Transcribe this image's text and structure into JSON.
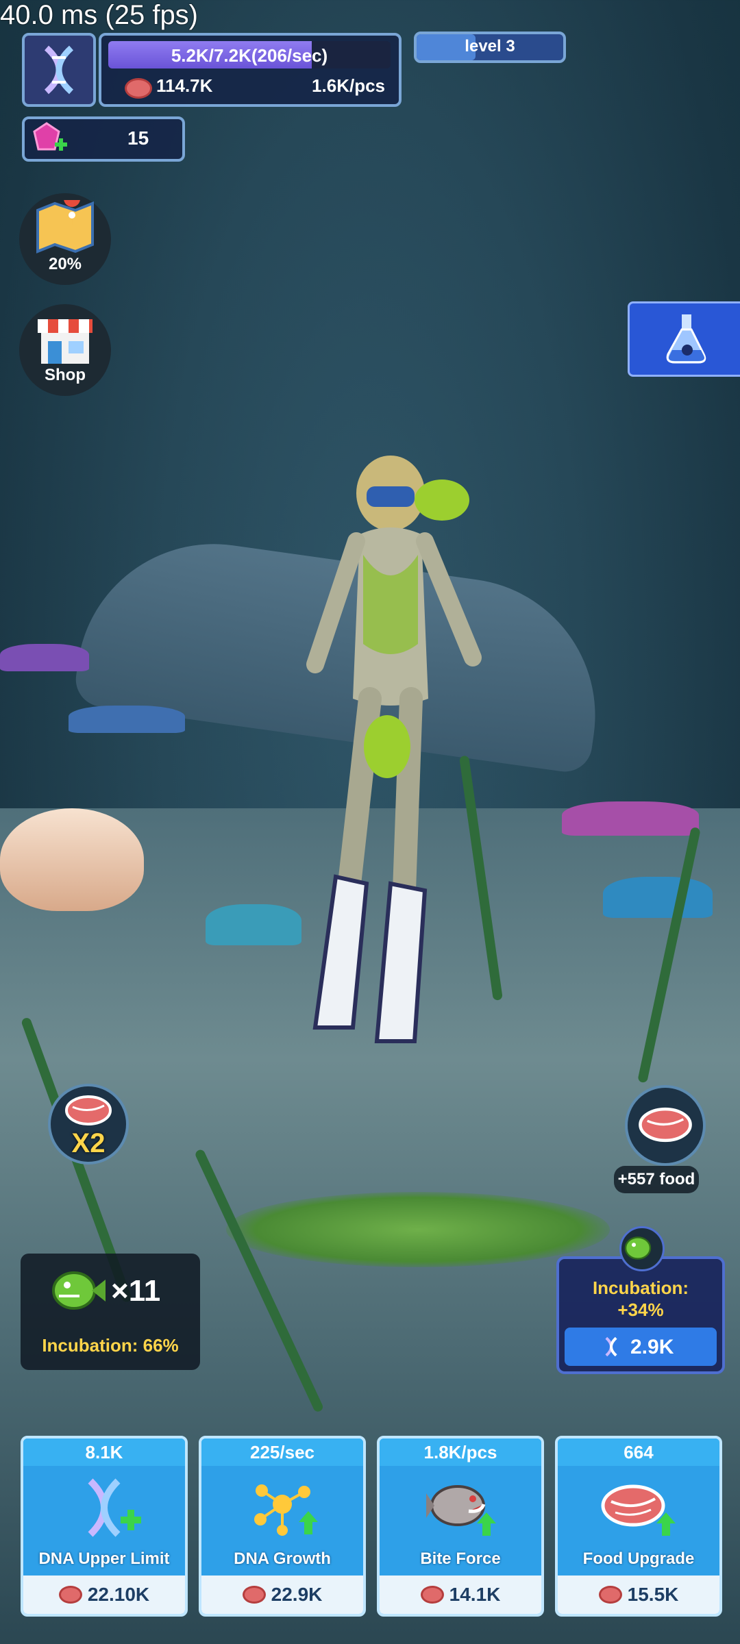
{
  "debug": {
    "fps_text": "40.0 ms (25 fps)"
  },
  "hud": {
    "dna": {
      "text": "5.2K/7.2K(206/sec)",
      "fill_fraction": 0.72
    },
    "food": {
      "amount": "114.7K",
      "rate": "1.6K/pcs"
    },
    "level": {
      "label": "level 3",
      "fill_fraction": 0.4
    },
    "gems": {
      "amount": "15"
    }
  },
  "side_buttons": {
    "map": {
      "label": "20%",
      "icon": "map-pin-icon"
    },
    "shop": {
      "label": "Shop",
      "icon": "storefront-icon"
    },
    "potion": {
      "icon": "potion-flask-icon"
    }
  },
  "bonus": {
    "x2_label": "X2",
    "food_badge": "+557 food"
  },
  "fish_panel": {
    "count": "×11",
    "incubation": "Incubation: 66%"
  },
  "incubation_panel": {
    "line1": "Incubation:",
    "line2": "+34%",
    "cost": "2.9K"
  },
  "upgrades": [
    {
      "top": "8.1K",
      "name": "DNA Upper Limit",
      "cost": "22.10K",
      "icon": "dna-plus-icon"
    },
    {
      "top": "225/sec",
      "name": "DNA Growth",
      "cost": "22.9K",
      "icon": "molecule-up-icon"
    },
    {
      "top": "1.8K/pcs",
      "name": "Bite Force",
      "cost": "14.1K",
      "icon": "piranha-up-icon"
    },
    {
      "top": "664",
      "name": "Food Upgrade",
      "cost": "15.5K",
      "icon": "steak-up-icon"
    }
  ],
  "colors": {
    "accent_blue": "#2ea0e8",
    "dna_purple": "#6a54d8",
    "incubation_yellow": "#ffd54a"
  }
}
